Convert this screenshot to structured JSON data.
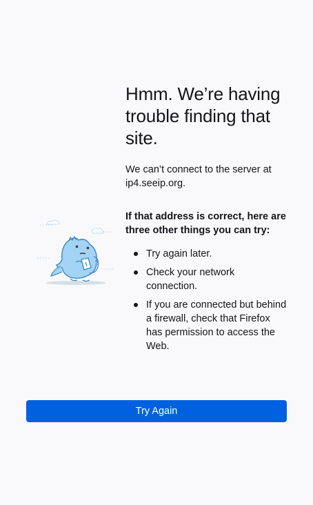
{
  "error": {
    "title": "Hmm. We’re having trouble finding that site.",
    "description": "We can’t connect to the server at ip4.seeip.org.",
    "subheading": "If that address is correct, here are three other things you can try:",
    "tips": [
      "Try again later.",
      "Check your network connection.",
      "If you are connected but behind a firewall, check that Firefox has permission to access the Web."
    ],
    "illustration_icon": "confused-dino-illustration"
  },
  "actions": {
    "try_again_label": "Try Again"
  },
  "colors": {
    "background": "#f9f9fb",
    "button": "#0061e0",
    "text": "#15141a",
    "illustration": "#a3d3f5"
  }
}
